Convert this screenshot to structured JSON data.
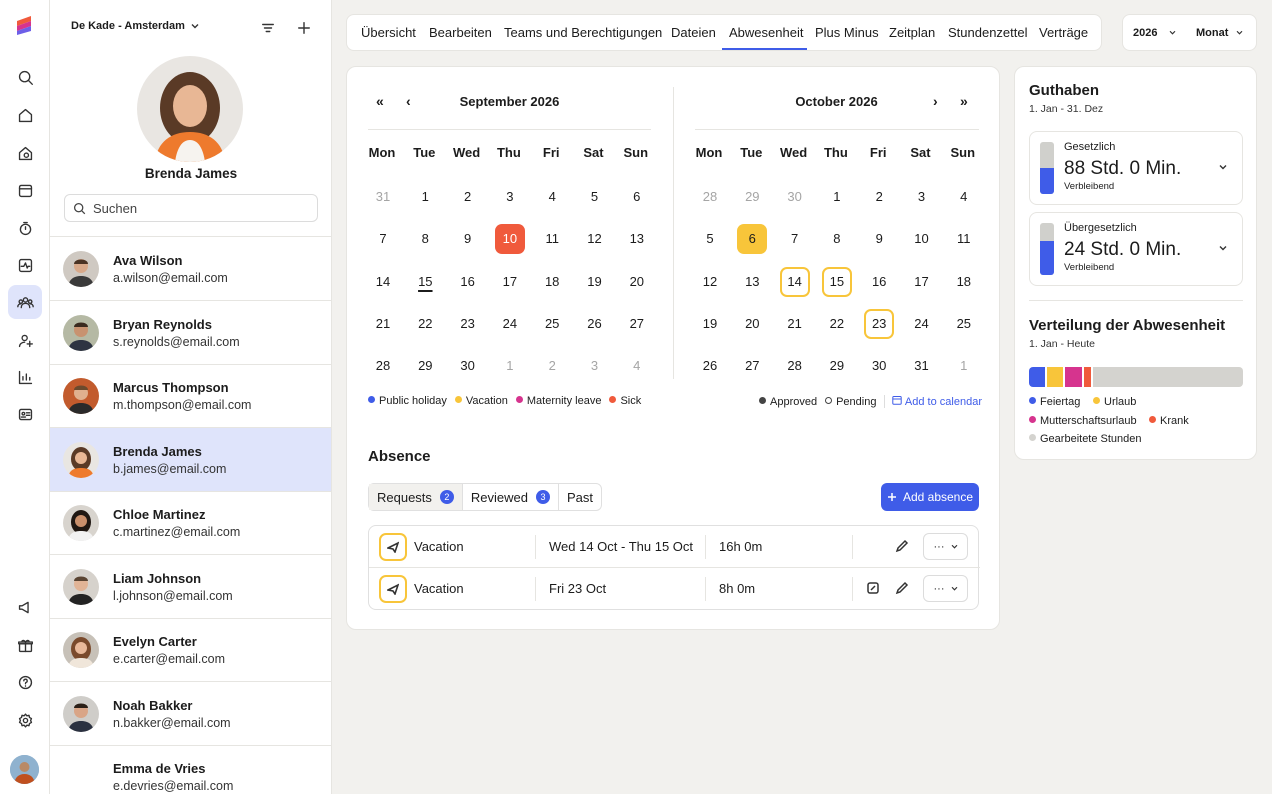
{
  "location": "De Kade - Amsterdam",
  "profile": {
    "name": "Brenda James"
  },
  "search": {
    "placeholder": "Suchen"
  },
  "people": [
    {
      "name": "Ava Wilson",
      "email": "a.wilson@email.com"
    },
    {
      "name": "Bryan Reynolds",
      "email": "s.reynolds@email.com"
    },
    {
      "name": "Marcus Thompson",
      "email": "m.thompson@email.com"
    },
    {
      "name": "Brenda James",
      "email": "b.james@email.com"
    },
    {
      "name": "Chloe Martinez",
      "email": "c.martinez@email.com"
    },
    {
      "name": "Liam Johnson",
      "email": "l.johnson@email.com"
    },
    {
      "name": "Evelyn Carter",
      "email": "e.carter@email.com"
    },
    {
      "name": "Noah Bakker",
      "email": "n.bakker@email.com"
    },
    {
      "name": "Emma de Vries",
      "email": "e.devries@email.com"
    }
  ],
  "tabs": [
    "Übersicht",
    "Bearbeiten",
    "Teams und Berechtigungen",
    "Dateien",
    "Abwesenheit",
    "Plus Minus",
    "Zeitplan",
    "Stundenzettel",
    "Verträge"
  ],
  "active_tab": "Abwesenheit",
  "year_select": "2026",
  "view_select": "Monat",
  "calendar": {
    "weekdays": [
      "Mon",
      "Tue",
      "Wed",
      "Thu",
      "Fri",
      "Sat",
      "Sun"
    ],
    "months": [
      {
        "title": "September 2026",
        "days": [
          [
            "31",
            "1",
            "2",
            "3",
            "4",
            "5",
            "6"
          ],
          [
            "7",
            "8",
            "9",
            "10",
            "11",
            "12",
            "13"
          ],
          [
            "14",
            "15",
            "16",
            "17",
            "18",
            "19",
            "20"
          ],
          [
            "21",
            "22",
            "23",
            "24",
            "25",
            "26",
            "27"
          ],
          [
            "28",
            "29",
            "30",
            "1",
            "2",
            "3",
            "4"
          ]
        ]
      },
      {
        "title": "October 2026",
        "days": [
          [
            "28",
            "29",
            "30",
            "1",
            "2",
            "3",
            "4"
          ],
          [
            "5",
            "6",
            "7",
            "8",
            "9",
            "10",
            "11"
          ],
          [
            "12",
            "13",
            "14",
            "15",
            "16",
            "17",
            "18"
          ],
          [
            "19",
            "20",
            "21",
            "22",
            "23",
            "24",
            "25"
          ],
          [
            "26",
            "27",
            "28",
            "29",
            "30",
            "31",
            "1"
          ]
        ]
      }
    ],
    "legend_types": [
      "Public holiday",
      "Vacation",
      "Maternity leave",
      "Sick"
    ],
    "legend_status": [
      "Approved",
      "Pending"
    ],
    "add_to_calendar": "Add to calendar"
  },
  "absence": {
    "title": "Absence",
    "tabs": [
      {
        "label": "Requests",
        "count": "2"
      },
      {
        "label": "Reviewed",
        "count": "3"
      },
      {
        "label": "Past"
      }
    ],
    "add_label": "Add absence",
    "rows": [
      {
        "type": "Vacation",
        "dates": "Wed 14 Oct - Thu 15 Oct",
        "duration": "16h 0m"
      },
      {
        "type": "Vacation",
        "dates": "Fri 23 Oct",
        "duration": "8h 0m"
      }
    ]
  },
  "balance": {
    "title": "Guthaben",
    "range": "1. Jan - 31. Dez",
    "items": [
      {
        "label": "Gesetzlich",
        "value": "88 Std. 0 Min.",
        "note": "Verbleibend",
        "fill_fraction": 0.5
      },
      {
        "label": "Übergesetzlich",
        "value": "24 Std. 0 Min.",
        "note": "Verbleibend",
        "fill_fraction": 0.65
      }
    ]
  },
  "distribution": {
    "title": "Verteilung der Abwesenheit",
    "range": "1. Jan - Heute",
    "segments": [
      {
        "label": "Feiertag",
        "color": "#3f5ce8",
        "share": 0.085
      },
      {
        "label": "Urlaub",
        "color": "#f8c53a",
        "share": 0.085
      },
      {
        "label": "Mutterschaftsurlaub",
        "color": "#d6348e",
        "share": 0.085
      },
      {
        "label": "Krank",
        "color": "#f05a3c",
        "share": 0.045
      },
      {
        "label": "Gearbeitete Stunden",
        "color": "#d4d3cf",
        "share": 0.7
      }
    ]
  }
}
